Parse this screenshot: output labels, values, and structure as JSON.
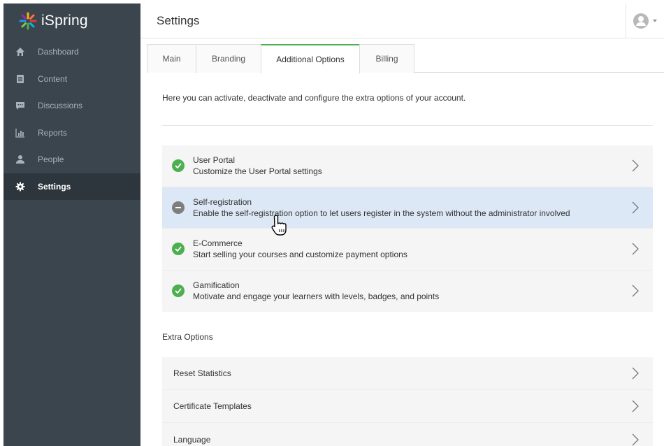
{
  "app": {
    "logo_text": "iSpring"
  },
  "sidebar": {
    "items": [
      {
        "label": "Dashboard",
        "icon": "home-icon"
      },
      {
        "label": "Content",
        "icon": "document-icon"
      },
      {
        "label": "Discussions",
        "icon": "chat-icon"
      },
      {
        "label": "Reports",
        "icon": "bar-chart-icon"
      },
      {
        "label": "People",
        "icon": "person-icon"
      },
      {
        "label": "Settings",
        "icon": "gear-icon",
        "active": true
      }
    ]
  },
  "header": {
    "title": "Settings"
  },
  "tabs": [
    {
      "label": "Main"
    },
    {
      "label": "Branding"
    },
    {
      "label": "Additional Options",
      "active": true
    },
    {
      "label": "Billing"
    }
  ],
  "main": {
    "intro": "Here you can activate, deactivate and configure the extra options of your account.",
    "options": [
      {
        "title": "User Portal",
        "desc": "Customize the User Portal settings",
        "status": "enabled"
      },
      {
        "title": "Self-registration",
        "desc": "Enable the self-registration option to let users register in the system without the administrator involved",
        "status": "disabled"
      },
      {
        "title": "E-Commerce",
        "desc": "Start selling your courses and customize payment options",
        "status": "enabled"
      },
      {
        "title": "Gamification",
        "desc": "Motivate and engage your learners with levels, badges, and points",
        "status": "enabled"
      }
    ],
    "extra_label": "Extra Options",
    "extras": [
      {
        "label": "Reset Statistics"
      },
      {
        "label": "Certificate Templates"
      },
      {
        "label": "Language"
      }
    ]
  },
  "colors": {
    "sidebar_bg": "#3b454e",
    "sidebar_active": "#2e363d",
    "accent_green": "#4caf50",
    "hover_row": "#dde8f6"
  }
}
